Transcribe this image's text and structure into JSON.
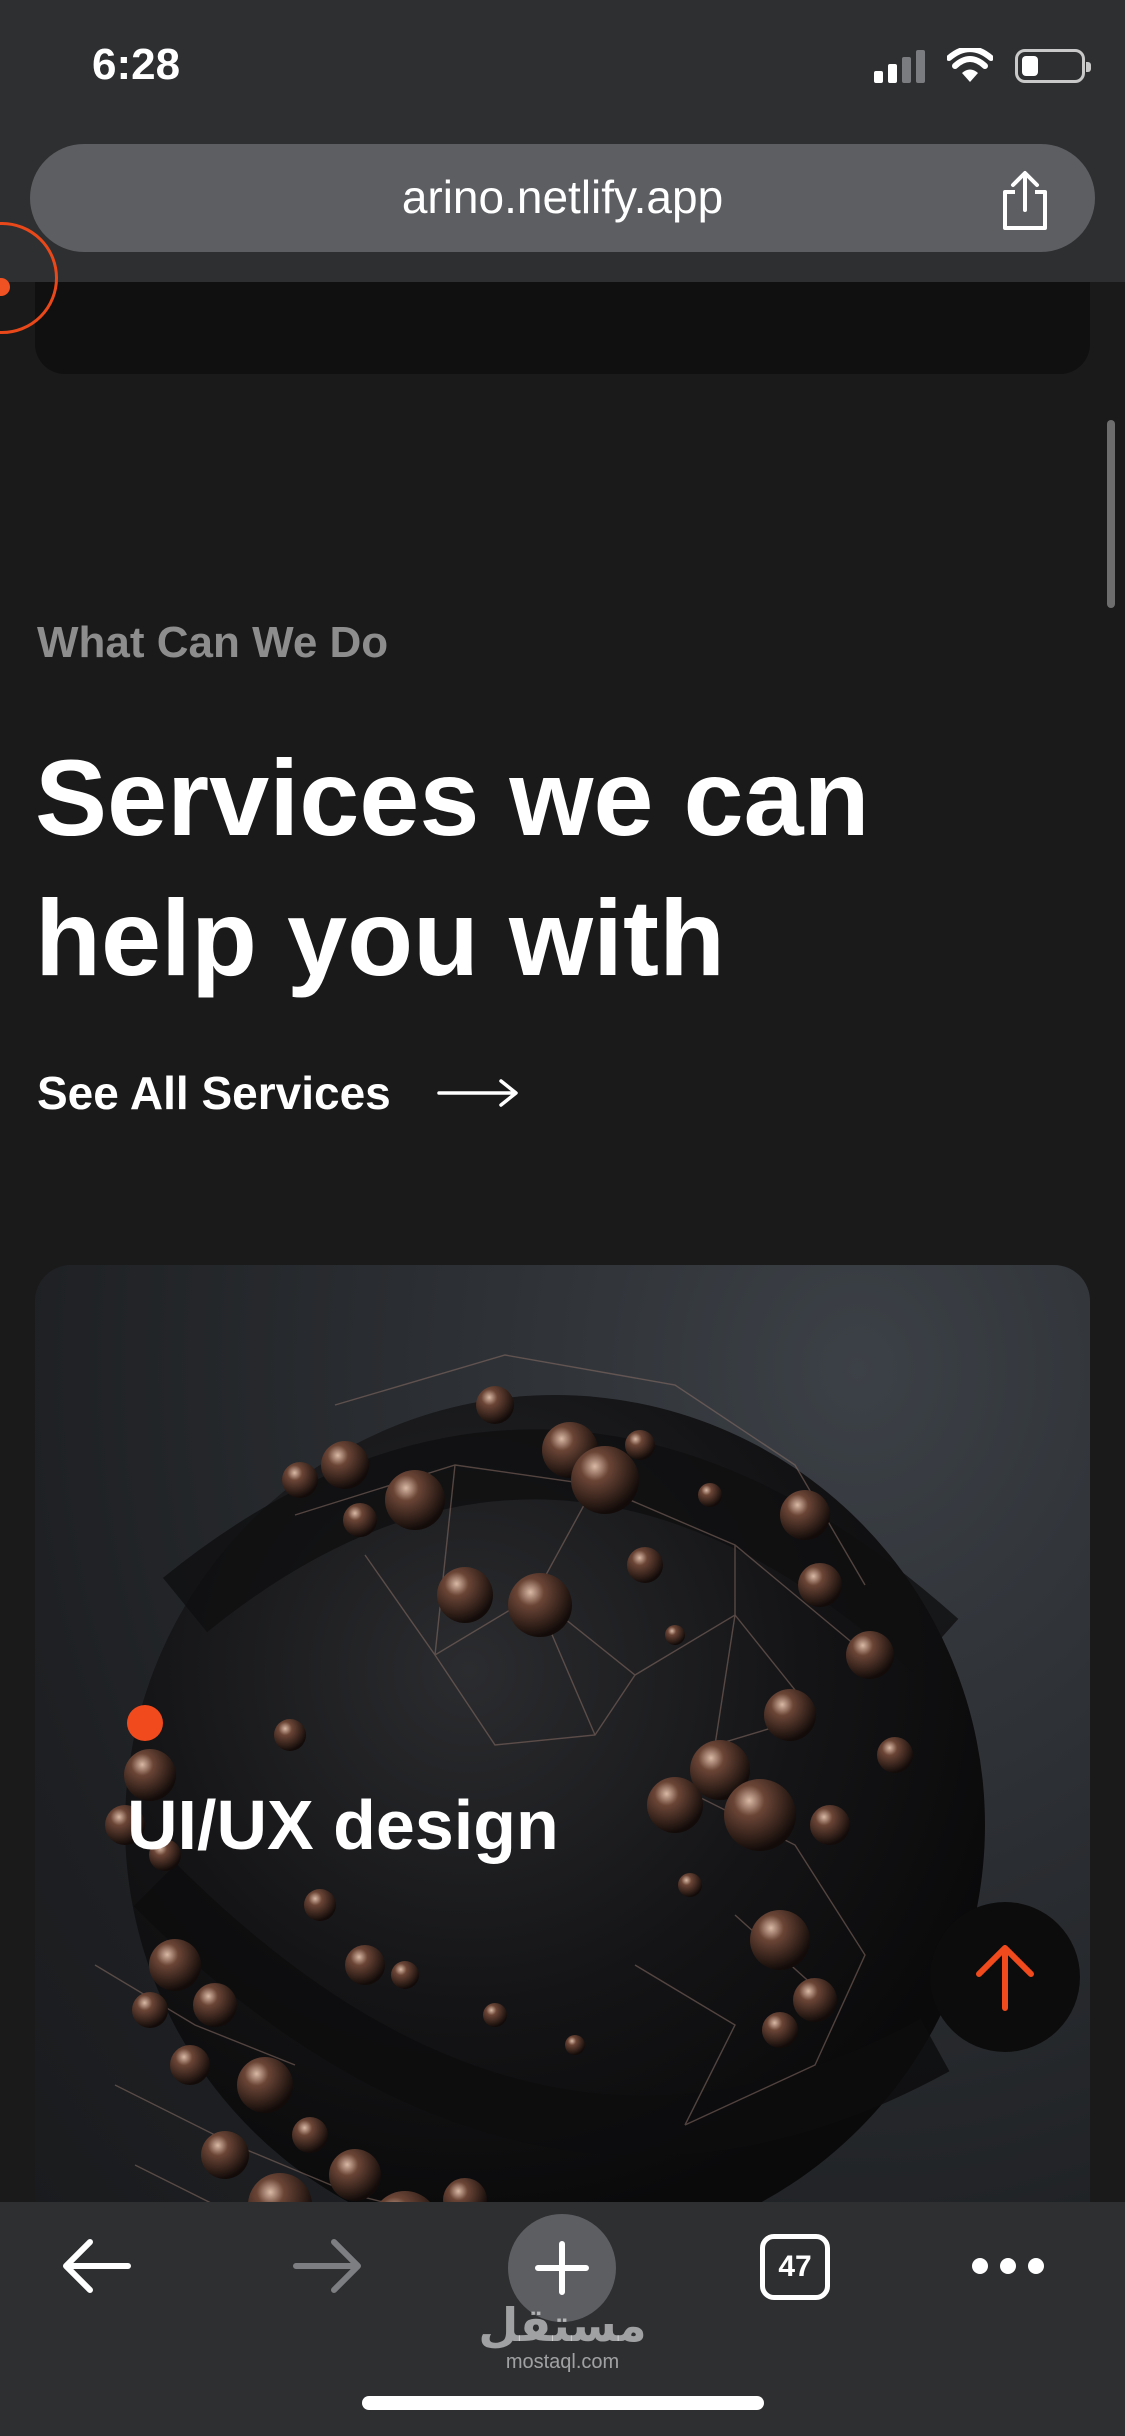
{
  "status_bar": {
    "time": "6:28",
    "icons": [
      "signal-icon",
      "wifi-icon",
      "battery-icon"
    ],
    "signal_bars_active": 2,
    "signal_bars_total": 4,
    "battery_level": 0.25
  },
  "browser": {
    "url": "arino.netlify.app",
    "share_icon": "share-icon",
    "tab_count": "47",
    "toolbar_icons": [
      "back-arrow-icon",
      "forward-arrow-icon",
      "plus-icon",
      "tabs-icon",
      "more-dots-icon"
    ]
  },
  "section": {
    "eyebrow": "What Can We Do",
    "headline_line1": "Services we can",
    "headline_line2": "help you with",
    "see_all_label": "See All Services"
  },
  "service_card": {
    "title": "UI/UX design"
  },
  "watermark": {
    "arabic": "مستقل",
    "latin": "mostaql.com"
  },
  "colors": {
    "accent": "#f04a1d",
    "background": "#1a1a1a",
    "chrome": "#2e2f31",
    "url_pill": "#5c5e61",
    "muted_text": "#8d8d8d"
  }
}
